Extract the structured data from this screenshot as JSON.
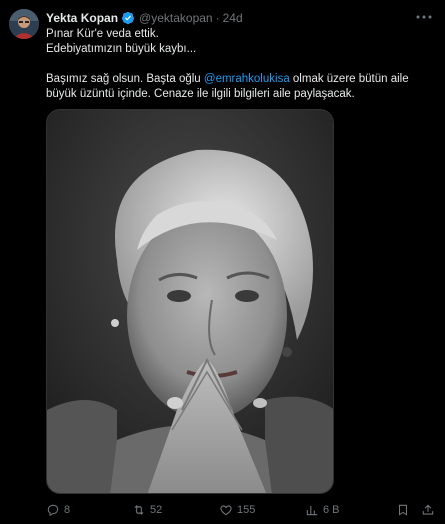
{
  "tweet": {
    "author_name": "Yekta Kopan",
    "handle": "@yektakopan",
    "separator": "·",
    "time": "24d",
    "text_lines": [
      "Pınar Kür'e veda ettik.",
      "Edebiyatımızın büyük kaybı..."
    ],
    "body_line1_prefix": "Başımız sağ olsun. Başta oğlu ",
    "mention": "@emrahkolukisa",
    "body_line1_suffix": " olmak üzere bütün aile",
    "body_line2": "büyük üzüntü içinde. Cenaze ile ilgili bilgileri aile paylaşacak.",
    "media_alt": "Black and white portrait photo"
  },
  "actions": {
    "replies": "8",
    "retweets": "52",
    "likes": "155",
    "views": "6 B"
  },
  "colors": {
    "background": "#000000",
    "text": "#e7e9ea",
    "muted": "#71767b",
    "accent": "#1d9bf0"
  },
  "icons": [
    "avatar",
    "verified-badge-icon",
    "more-icon",
    "reply-icon",
    "retweet-icon",
    "like-icon",
    "views-icon",
    "bookmark-icon",
    "share-icon"
  ]
}
